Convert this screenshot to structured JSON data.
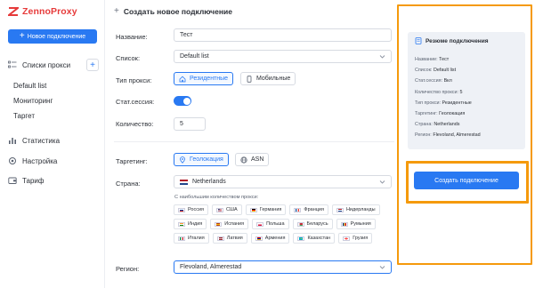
{
  "brand": {
    "name": "ZennoProxy",
    "color": "#e63a3a",
    "accent": "#2979f2",
    "highlight": "#f59a0c"
  },
  "sidebar": {
    "new_button": "Новое подключение",
    "proxy_lists": {
      "label": "Списки прокси",
      "items": [
        "Default list",
        "Мониторинг",
        "Таргет"
      ]
    },
    "items": [
      {
        "label": "Статистика",
        "icon": "bar-chart-icon"
      },
      {
        "label": "Настройка",
        "icon": "gear-icon"
      },
      {
        "label": "Тариф",
        "icon": "wallet-icon"
      }
    ]
  },
  "form": {
    "title": "Создать новое подключение",
    "name_label": "Название:",
    "name_value": "Тест",
    "list_label": "Список:",
    "list_value": "Default list",
    "proxy_type_label": "Тип прокси:",
    "proxy_types": [
      "Резидентные",
      "Мобильные"
    ],
    "proxy_type_selected": "Резидентные",
    "static_session_label": "Стат.сессия:",
    "static_session_on": true,
    "count_label": "Количество:",
    "count_value": "5",
    "targeting_label": "Таргетинг:",
    "targeting_options": [
      "Геолокация",
      "ASN"
    ],
    "targeting_selected": "Геолокация",
    "country_label": "Страна:",
    "country_value": "Netherlands",
    "countries_hint": "С наибольшим количеством прокси:",
    "countries": [
      "Россия",
      "США",
      "Германия",
      "Франция",
      "Нидерланды",
      "Индия",
      "Испания",
      "Польша",
      "Беларусь",
      "Румыния",
      "Италия",
      "Латвия",
      "Армения",
      "Казахстан",
      "Грузия"
    ],
    "region_label": "Регион:",
    "region_value": "Flevoland, Almerestad"
  },
  "summary": {
    "title": "Резюме подключения",
    "rows": [
      {
        "key": "Название:",
        "value": "Тест"
      },
      {
        "key": "Список:",
        "value": "Default list"
      },
      {
        "key": "Стат.сессия:",
        "value": "Вкл"
      },
      {
        "key": "Количество прокси:",
        "value": "5"
      },
      {
        "key": "Тип прокси:",
        "value": "Резидентные"
      },
      {
        "key": "Таргетинг:",
        "value": "Геолокация"
      },
      {
        "key": "Страна:",
        "value": "Netherlands"
      },
      {
        "key": "Регион:",
        "value": "Flevoland, Almerestad"
      }
    ],
    "create_button": "Создать подключение"
  }
}
